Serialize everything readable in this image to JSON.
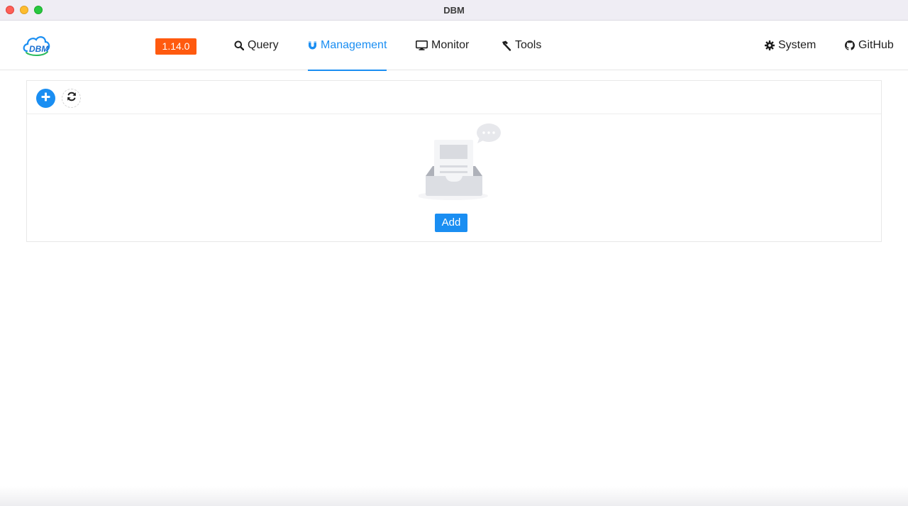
{
  "window": {
    "title": "DBM"
  },
  "header": {
    "version": "1.14.0",
    "nav": {
      "query": "Query",
      "management": "Management",
      "monitor": "Monitor",
      "tools": "Tools",
      "system": "System",
      "github": "GitHub"
    },
    "active_tab": "management"
  },
  "icons": {
    "logo": "dbm-cloud-logo-icon",
    "query": "search-icon",
    "management": "magnet-icon",
    "monitor": "monitor-icon",
    "tools": "hammer-icon",
    "system": "gear-icon",
    "github": "github-icon",
    "add": "plus-circle-icon",
    "refresh": "refresh-icon",
    "empty": "empty-inbox-icon"
  },
  "main": {
    "empty_action_label": "Add"
  },
  "colors": {
    "accent": "#1a8ef2",
    "version_badge": "#ff5a0f"
  }
}
